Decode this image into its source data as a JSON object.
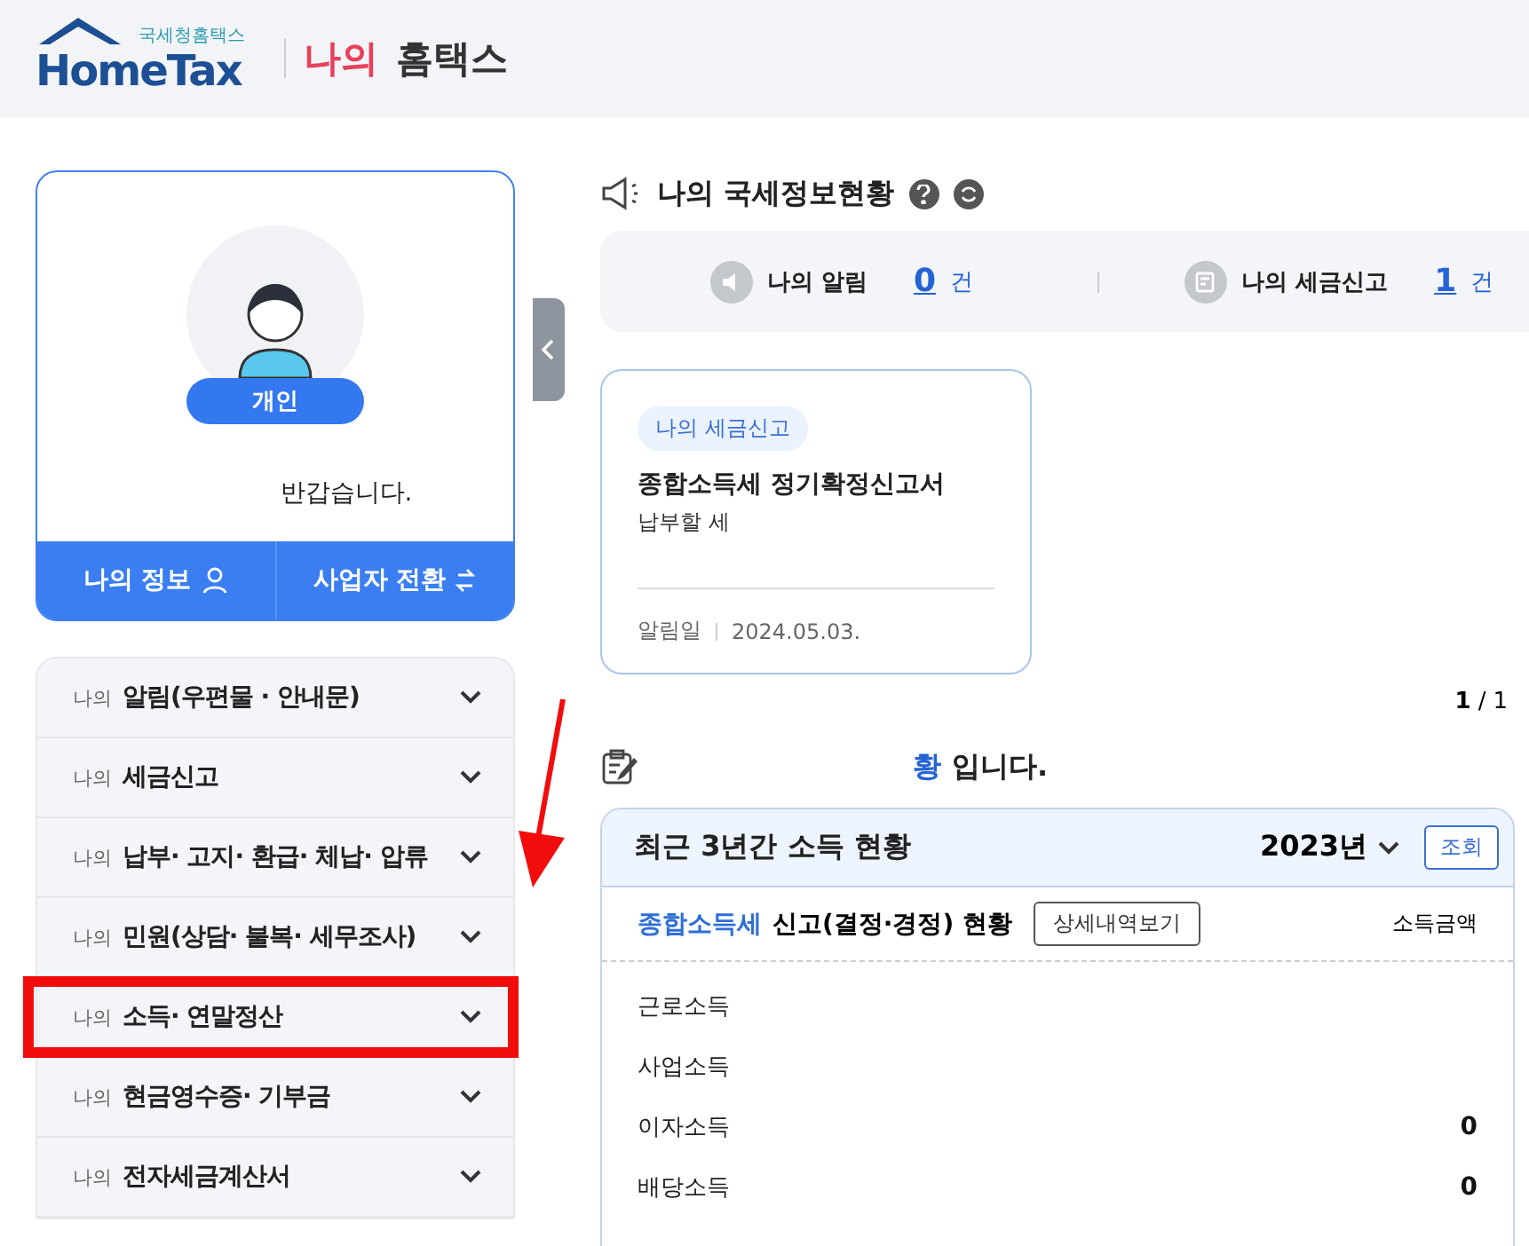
{
  "header": {
    "logo_small": "국세청홈택스",
    "logo_main": "HomeTax",
    "title_accent": "나의",
    "title": "홈택스"
  },
  "profile": {
    "badge": "개인",
    "greeting": "반갑습니다.",
    "buttons": [
      {
        "label": "나의 정보",
        "kind": "person"
      },
      {
        "label": "사업자 전환",
        "kind": "switch"
      }
    ]
  },
  "menu": [
    {
      "prefix": "나의",
      "label": "알림(우편물 · 안내문)",
      "highlighted": false
    },
    {
      "prefix": "나의",
      "label": "세금신고",
      "highlighted": false
    },
    {
      "prefix": "나의",
      "label": "납부· 고지· 환급· 체납· 압류",
      "highlighted": false
    },
    {
      "prefix": "나의",
      "label": "민원(상담· 불복· 세무조사)",
      "highlighted": false
    },
    {
      "prefix": "나의",
      "label": "소득· 연말정산",
      "highlighted": true
    },
    {
      "prefix": "나의",
      "label": "현금영수증· 기부금",
      "highlighted": false
    },
    {
      "prefix": "나의",
      "label": "전자세금계산서",
      "highlighted": false
    }
  ],
  "status": {
    "title": "나의 국세정보현황",
    "items": [
      {
        "label": "나의 알림",
        "count": "0",
        "unit": "건",
        "kind": "speaker"
      },
      {
        "label": "나의 세금신고",
        "count": "1",
        "unit": "건",
        "kind": "report"
      }
    ]
  },
  "notice": {
    "tag": "나의 세금신고",
    "title": "종합소득세 정기확정신고서",
    "body": "납부할 세",
    "date_label": "알림일",
    "date": "2024.05.03."
  },
  "pagination": {
    "current": "1",
    "separator": "/",
    "total": "1"
  },
  "section": {
    "highlight": "황",
    "rest": "입니다."
  },
  "income": {
    "title": "최근 3년간 소득 현황",
    "year": "2023년",
    "query_button": "조회",
    "subtitle_accent": "종합소득세",
    "subtitle": "신고(결정·경정) 현황",
    "detail_button": "상세내역보기",
    "amount_header": "소득금액",
    "rows": [
      {
        "label": "근로소득"
      },
      {
        "label": "사업소득"
      },
      {
        "label": "이자소득",
        "amount": "0"
      },
      {
        "label": "배당소득",
        "amount": "0"
      }
    ]
  }
}
